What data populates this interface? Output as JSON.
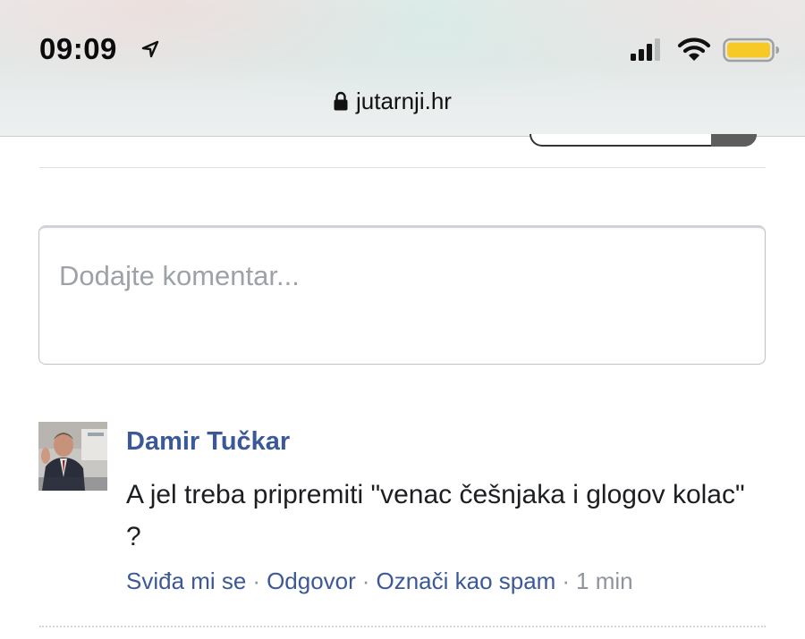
{
  "status_bar": {
    "time": "09:09",
    "icons": [
      "location-arrow-icon",
      "cellular-signal-icon",
      "wifi-icon",
      "battery-icon"
    ],
    "battery_color": "#f7c926"
  },
  "url_bar": {
    "url": "jutarnji.hr",
    "icon": "lock-icon"
  },
  "comment_form": {
    "placeholder": "Dodajte komentar..."
  },
  "comments": [
    {
      "author": "Damir Tučkar",
      "text": "A jel treba pripremiti \"venac češnjaka i glogov kolac\" ?",
      "actions": {
        "like": "Sviđa mi se",
        "reply": "Odgovor",
        "spam": "Označi kao spam",
        "separator": "·",
        "time_ago": "1 min"
      }
    }
  ],
  "colors": {
    "link": "#3b5998",
    "meta": "#8d949e",
    "text": "#1c1e21"
  }
}
